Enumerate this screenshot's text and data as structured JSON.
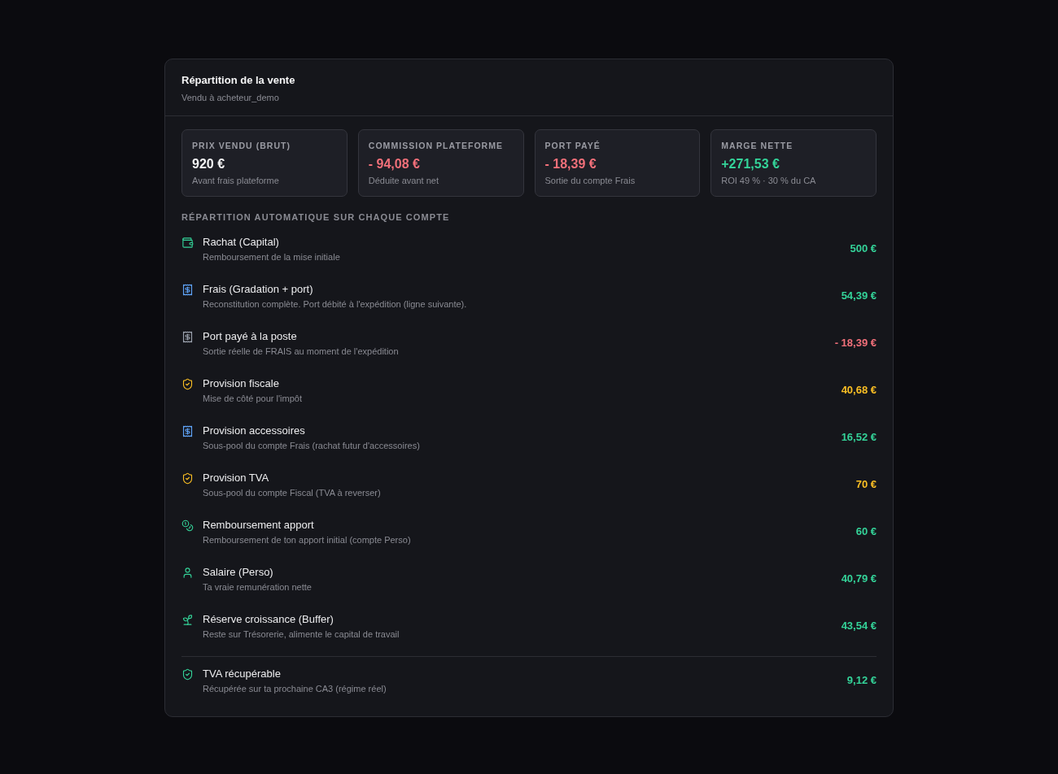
{
  "header": {
    "title": "Répartition de la vente",
    "subtitle": "Vendu à acheteur_demo"
  },
  "stats": [
    {
      "label": "PRIX VENDU (BRUT)",
      "value": "920 €",
      "color": "#f4f4f5",
      "note": "Avant frais plateforme"
    },
    {
      "label": "COMMISSION PLATEFORME",
      "value": "- 94,08 €",
      "color": "#f2707a",
      "note": "Déduite avant net"
    },
    {
      "label": "PORT PAYÉ",
      "value": "- 18,39 €",
      "color": "#f2707a",
      "note": "Sortie du compte Frais"
    },
    {
      "label": "MARGE NETTE",
      "value": "+271,53 €",
      "color": "#34d399",
      "note": "ROI 49 % · 30 % du CA"
    }
  ],
  "section_heading": "RÉPARTITION AUTOMATIQUE SUR CHAQUE COMPTE",
  "accounts": [
    {
      "kind": "capital",
      "name": "Rachat (Capital)",
      "description": "Remboursement de la mise initiale",
      "amount": "500 €",
      "color": "#34d399"
    },
    {
      "kind": "fees",
      "name": "Frais (Gradation + port)",
      "description": "Reconstitution complète. Port débité à l'expédition (ligne suivante).",
      "amount": "54,39 €",
      "color": "#34d399"
    },
    {
      "kind": "shipping",
      "name": "Port payé à la poste",
      "description": "Sortie réelle de FRAIS au moment de l'expédition",
      "amount": "- 18,39 €",
      "color": "#f2707a"
    },
    {
      "kind": "tax",
      "name": "Provision fiscale",
      "description": "Mise de côté pour l'impôt",
      "amount": "40,68 €",
      "color": "#fbbf24"
    },
    {
      "kind": "fees",
      "name": "Provision accessoires",
      "description": "Sous-pool du compte Frais (rachat futur d'accessoires)",
      "amount": "16,52 €",
      "color": "#34d399"
    },
    {
      "kind": "tax",
      "name": "Provision TVA",
      "description": "Sous-pool du compte Fiscal (TVA à reverser)",
      "amount": "70 €",
      "color": "#fbbf24"
    },
    {
      "kind": "contribution",
      "name": "Remboursement apport",
      "description": "Remboursement de ton apport initial (compte Perso)",
      "amount": "60 €",
      "color": "#34d399"
    },
    {
      "kind": "salary",
      "name": "Salaire (Perso)",
      "description": "Ta vraie remunération nette",
      "amount": "40,79 €",
      "color": "#34d399"
    },
    {
      "kind": "growth",
      "name": "Réserve croissance (Buffer)",
      "description": "Reste sur Trésorerie, alimente le capital de travail",
      "amount": "43,54 €",
      "color": "#34d399"
    }
  ],
  "recoverable": [
    {
      "kind": "refund",
      "name": "TVA récupérable",
      "description": "Récupérée sur ta prochaine CA3 (régime réel)",
      "amount": "9,12 €",
      "color": "#34d399"
    }
  ]
}
